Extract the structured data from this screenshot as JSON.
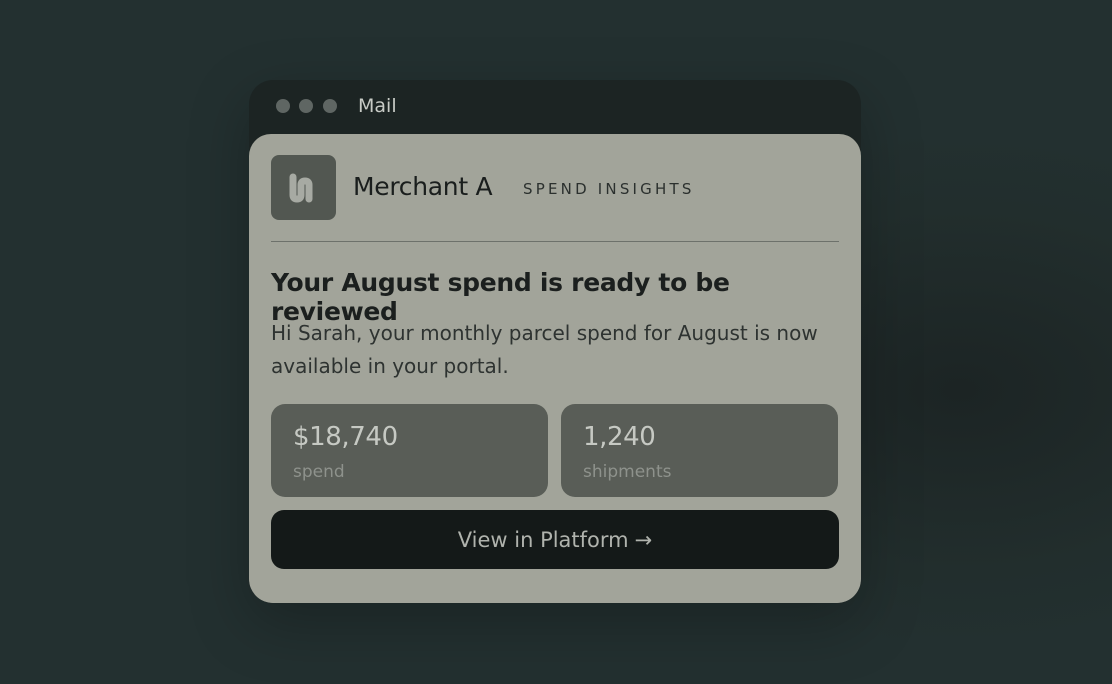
{
  "window": {
    "title": "Mail"
  },
  "email": {
    "sender": "Merchant A",
    "category": "SPEND INSIGHTS",
    "logo_icon": "brand-logo-icon",
    "headline": "Your August spend is ready to be reviewed",
    "body": "Hi Sarah, your monthly parcel spend for August is now available in your portal.",
    "stats": [
      {
        "value": "$18,740",
        "label": "spend"
      },
      {
        "value": "1,240",
        "label": "shipments"
      }
    ],
    "cta": {
      "label": "View in Platform",
      "arrow": "→"
    }
  }
}
